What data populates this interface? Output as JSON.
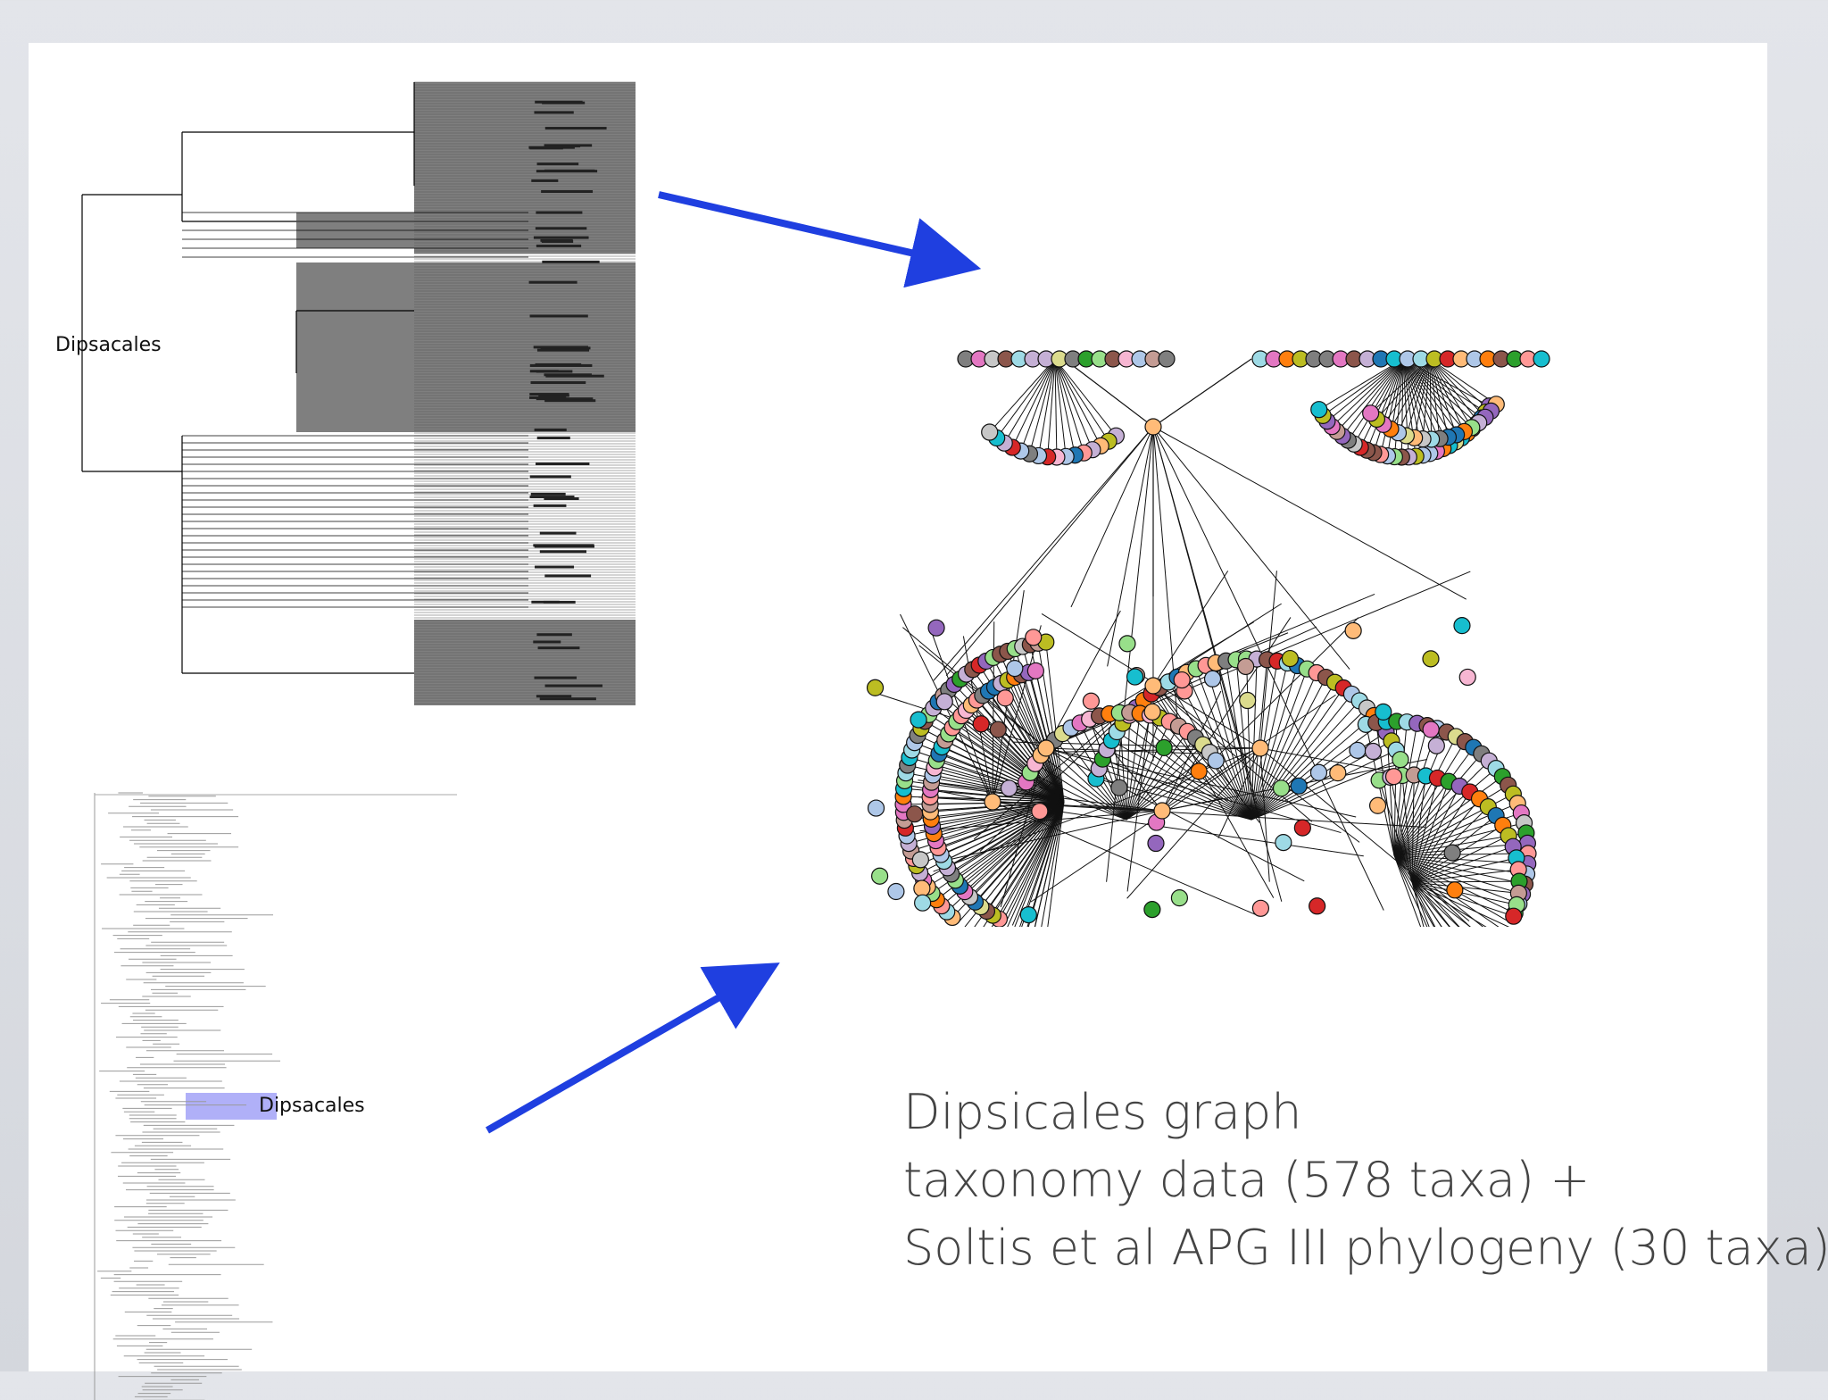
{
  "slide": {
    "top_tree_label": "Dipsacales",
    "bottom_tree_label": "Dipsacales",
    "caption": {
      "line1": "Dipsicales graph",
      "line2": "taxonomy data (578 taxa) +",
      "line3": "Soltis et al APG III phylogeny (30 taxa)"
    }
  },
  "colors": {
    "arrow": "#1f3fe0",
    "highlight": "#b0b0f8",
    "tree_fill": "#7f7f7f",
    "node_palette": [
      "#aec7e8",
      "#ffbb78",
      "#98df8a",
      "#ff9896",
      "#c5b0d5",
      "#c49c94",
      "#f7b6d2",
      "#c7c7c7",
      "#dbdb8d",
      "#9edae5",
      "#1f77b4",
      "#ff7f0e",
      "#2ca02c",
      "#d62728",
      "#9467bd",
      "#8c564b",
      "#e377c2",
      "#7f7f7f",
      "#bcbd22",
      "#17becf"
    ]
  }
}
